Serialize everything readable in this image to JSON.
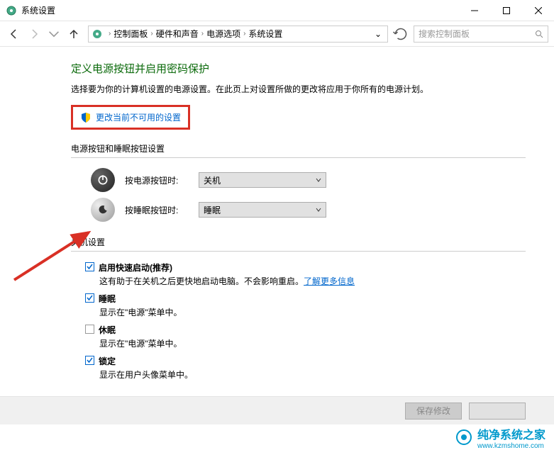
{
  "window": {
    "title": "系统设置"
  },
  "breadcrumb": {
    "items": [
      "控制面板",
      "硬件和声音",
      "电源选项",
      "系统设置"
    ]
  },
  "search": {
    "placeholder": "搜索控制面板"
  },
  "page": {
    "heading": "定义电源按钮并启用密码保护",
    "subtext": "选择要为你的计算机设置的电源设置。在此页上对设置所做的更改将应用于你所有的电源计划。",
    "admin_link": "更改当前不可用的设置"
  },
  "buttons_section": {
    "label": "电源按钮和睡眠按钮设置",
    "power_label": "按电源按钮时:",
    "power_value": "关机",
    "sleep_label": "按睡眠按钮时:",
    "sleep_value": "睡眠"
  },
  "shutdown_section": {
    "label": "关机设置",
    "opts": [
      {
        "title": "启用快速启动(推荐)",
        "desc": "这有助于在关机之后更快地启动电脑。不会影响重启。",
        "link": "了解更多信息",
        "checked": true
      },
      {
        "title": "睡眠",
        "desc": "显示在\"电源\"菜单中。",
        "checked": true
      },
      {
        "title": "休眠",
        "desc": "显示在\"电源\"菜单中。",
        "checked": false
      },
      {
        "title": "锁定",
        "desc": "显示在用户头像菜单中。",
        "checked": true
      }
    ]
  },
  "footer": {
    "save": "保存修改",
    "cancel": ""
  },
  "watermark": {
    "text": "纯净系统之家",
    "url": "www.kzmshome.com"
  }
}
